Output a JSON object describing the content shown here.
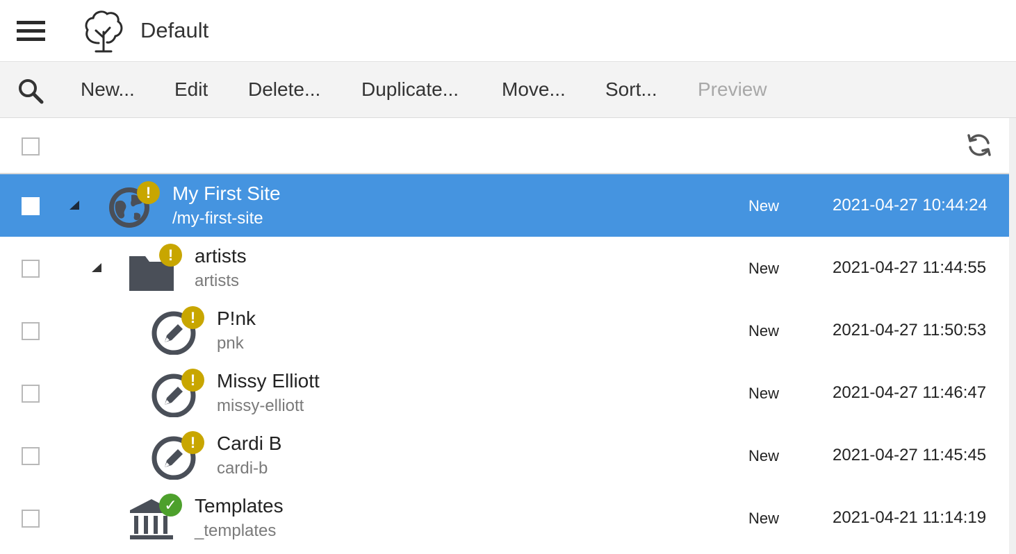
{
  "header": {
    "title": "Default",
    "menu_icon": "hamburger-icon",
    "logo_icon": "tree-logo-icon"
  },
  "toolbar": {
    "search_icon": "search-icon",
    "items": [
      {
        "label": "New...",
        "enabled": true
      },
      {
        "label": "Edit",
        "enabled": true
      },
      {
        "label": "Delete...",
        "enabled": true
      },
      {
        "label": "Duplicate...",
        "enabled": true
      },
      {
        "label": "Move...",
        "enabled": true
      },
      {
        "label": "Sort...",
        "enabled": true
      },
      {
        "label": "Preview",
        "enabled": false
      }
    ]
  },
  "list": {
    "refresh_icon": "refresh-icon",
    "rows": [
      {
        "title": "My First Site",
        "subtitle": "/my-first-site",
        "status": "New",
        "date": "2021-04-27 10:44:24",
        "icon": "globe-icon",
        "badge": "warning",
        "selected": true,
        "expanded": true
      },
      {
        "title": "artists",
        "subtitle": "artists",
        "status": "New",
        "date": "2021-04-27 11:44:55",
        "icon": "folder-icon",
        "badge": "warning",
        "selected": false,
        "expanded": true
      },
      {
        "title": "P!nk",
        "subtitle": "pnk",
        "status": "New",
        "date": "2021-04-27 11:50:53",
        "icon": "pencil-icon",
        "badge": "warning",
        "selected": false
      },
      {
        "title": "Missy Elliott",
        "subtitle": "missy-elliott",
        "status": "New",
        "date": "2021-04-27 11:46:47",
        "icon": "pencil-icon",
        "badge": "warning",
        "selected": false
      },
      {
        "title": "Cardi B",
        "subtitle": "cardi-b",
        "status": "New",
        "date": "2021-04-27 11:45:45",
        "icon": "pencil-icon",
        "badge": "warning",
        "selected": false
      },
      {
        "title": "Templates",
        "subtitle": "_templates",
        "status": "New",
        "date": "2021-04-21 11:14:19",
        "icon": "templates-icon",
        "badge": "ok",
        "selected": false
      }
    ]
  },
  "colors": {
    "selection": "#4594e0",
    "warning_badge": "#c8a600",
    "ok_badge": "#4da02c",
    "icon_dark": "#4a4f58"
  }
}
